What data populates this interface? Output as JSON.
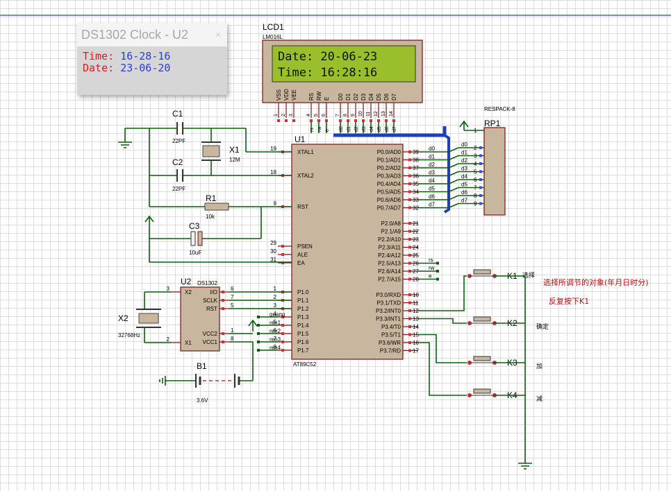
{
  "dialog": {
    "title": "DS1302 Clock - U2",
    "close_glyph": "×",
    "time_label": "Time:",
    "time_value": "16-28-16",
    "date_label": "Date:",
    "date_value": "23-06-20"
  },
  "lcd": {
    "ref": "LCD1",
    "model": "LM016L",
    "line1": "Date: 20-06-23",
    "line2": "Time: 16:28:16",
    "pins": [
      "VSS",
      "VDD",
      "VEE",
      "RS",
      "RW",
      "E",
      "D0",
      "D1",
      "D2",
      "D3",
      "D4",
      "D5",
      "D6",
      "D7"
    ],
    "pin_numbers": [
      "1",
      "2",
      "3",
      "4",
      "5",
      "6",
      "7",
      "8",
      "9",
      "10",
      "11",
      "12",
      "13",
      "14"
    ],
    "net_names": [
      "rs",
      "rw",
      "e",
      "d0",
      "d1",
      "d2",
      "d3",
      "d4",
      "d5",
      "d6",
      "d7"
    ]
  },
  "u1": {
    "ref": "U1",
    "model": "AT89C52",
    "left_pins": [
      {
        "num": "19",
        "name": "XTAL1"
      },
      {
        "num": "18",
        "name": "XTAL2"
      },
      {
        "num": "9",
        "name": "RST"
      },
      {
        "num": "29",
        "name": "PSEN"
      },
      {
        "num": "30",
        "name": "ALE"
      },
      {
        "num": "31",
        "name": "EA"
      },
      {
        "num": "1",
        "name": "P1.0"
      },
      {
        "num": "2",
        "name": "P1.1"
      },
      {
        "num": "3",
        "name": "P1.2"
      },
      {
        "num": "4",
        "name": "P1.3"
      },
      {
        "num": "5",
        "name": "P1.4"
      },
      {
        "num": "6",
        "name": "P1.5"
      },
      {
        "num": "7",
        "name": "P1.6"
      },
      {
        "num": "8",
        "name": "P1.7"
      }
    ],
    "right_pins": [
      {
        "num": "39",
        "name": "P0.0/AD0"
      },
      {
        "num": "38",
        "name": "P0.1/AD1"
      },
      {
        "num": "37",
        "name": "P0.2/AD2"
      },
      {
        "num": "36",
        "name": "P0.3/AD3"
      },
      {
        "num": "35",
        "name": "P0.4/AD4"
      },
      {
        "num": "34",
        "name": "P0.5/AD5"
      },
      {
        "num": "33",
        "name": "P0.6/AD6"
      },
      {
        "num": "32",
        "name": "P0.7/AD7"
      },
      {
        "num": "21",
        "name": "P2.0/A8"
      },
      {
        "num": "22",
        "name": "P2.1/A9"
      },
      {
        "num": "23",
        "name": "P2.2/A10"
      },
      {
        "num": "24",
        "name": "P2.3/A11"
      },
      {
        "num": "25",
        "name": "P2.4/A12"
      },
      {
        "num": "26",
        "name": "P2.5/A13"
      },
      {
        "num": "27",
        "name": "P2.6/A14"
      },
      {
        "num": "28",
        "name": "P2.7/A15"
      },
      {
        "num": "10",
        "name": "P3.0/RXD"
      },
      {
        "num": "11",
        "name": "P3.1/TXD"
      },
      {
        "num": "12",
        "name": "P3.2/INT0"
      },
      {
        "num": "13",
        "name": "P3.3/INT1"
      },
      {
        "num": "14",
        "name": "P3.4/T0"
      },
      {
        "num": "15",
        "name": "P3.5/T1"
      },
      {
        "num": "16",
        "name": "P3.6/WR"
      },
      {
        "num": "17",
        "name": "P3.7/RD"
      }
    ],
    "p0_nets": [
      "d0",
      "d1",
      "d2",
      "d3",
      "d4",
      "d5",
      "d6",
      "d7"
    ],
    "p2_nets": [
      "rs",
      "rw",
      "e"
    ],
    "p1_nets": [
      "guang",
      "ren1",
      "ren2",
      "ren3",
      "ren4"
    ]
  },
  "u2": {
    "ref": "U2",
    "model": "DS1302",
    "left_pins": [
      {
        "num": "3",
        "name": "X2"
      },
      {
        "num": "2",
        "name": "X1"
      }
    ],
    "right_pins": [
      {
        "num": "6",
        "name": "I/O"
      },
      {
        "num": "7",
        "name": "SCLK"
      },
      {
        "num": "5",
        "name": "RST"
      },
      {
        "num": "1",
        "name": "VCC2"
      },
      {
        "num": "8",
        "name": "VCC1"
      }
    ]
  },
  "rp1": {
    "ref": "RP1",
    "model": "RESPACK-8",
    "pin_numbers": [
      "1",
      "2",
      "3",
      "4",
      "5",
      "6",
      "7",
      "8",
      "9"
    ],
    "nets": [
      "d0",
      "d1",
      "d2",
      "d3",
      "d4",
      "d5",
      "d6",
      "d7"
    ]
  },
  "c1": {
    "ref": "C1",
    "value": "22PF"
  },
  "c2": {
    "ref": "C2",
    "value": "22PF"
  },
  "c3": {
    "ref": "C3",
    "value": "10uF"
  },
  "x1": {
    "ref": "X1",
    "value": "12M"
  },
  "x2": {
    "ref": "X2",
    "value": "32768Hz"
  },
  "r1": {
    "ref": "R1",
    "value": "10k"
  },
  "b1": {
    "ref": "B1",
    "value": "3.6V"
  },
  "keys": [
    {
      "ref": "K1",
      "label": "选择"
    },
    {
      "ref": "K2",
      "label": "确定"
    },
    {
      "ref": "K3",
      "label": "加"
    },
    {
      "ref": "K4",
      "label": "减"
    }
  ],
  "notes": {
    "line1": "选择所调节的对象(年月日时分)",
    "line2": "反复按下K1"
  },
  "colors": {
    "wire": "#0b5e0b",
    "chip_fill": "#c9b69e",
    "chip_border": "#7a1010",
    "lcd_bg": "#9bbf2a",
    "bus": "#1f3fb8",
    "note_red": "#b01010"
  }
}
